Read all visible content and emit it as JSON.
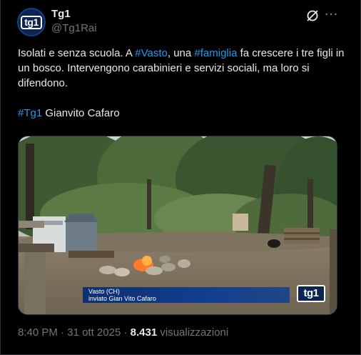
{
  "author": {
    "name": "Tg1",
    "handle": "@Tg1Rai",
    "avatar_logo": "tg1"
  },
  "tweet": {
    "line1_a": "Isolati e senza scuola. A ",
    "hashtag_vasto": "#Vasto",
    "line1_b": ", una ",
    "hashtag_famiglia": "#famiglia",
    "line1_c": " fa crescere i tre figli in un bosco. Intervengono carabinieri e servizi sociali, ma loro si difendono.",
    "hashtag_tg1": "#Tg1",
    "signature": " Gianvito Cafaro"
  },
  "video_caption": {
    "location": "Vasto (CH)",
    "reporter": "inviato Gian Vito Cafaro",
    "logo": "tg1"
  },
  "meta": {
    "time": "8:40 PM",
    "separator1": " · ",
    "date": "31 ott 2025",
    "separator2": " · ",
    "views_count": "8.431",
    "views_label": " visualizzazioni"
  },
  "icons": {
    "grok": "grok-icon",
    "more": "more-icon"
  },
  "colors": {
    "background": "#000000",
    "text": "#e7e9ea",
    "secondary": "#71767b",
    "link": "#1d9bf0",
    "caption_blue": "#123f8f"
  }
}
